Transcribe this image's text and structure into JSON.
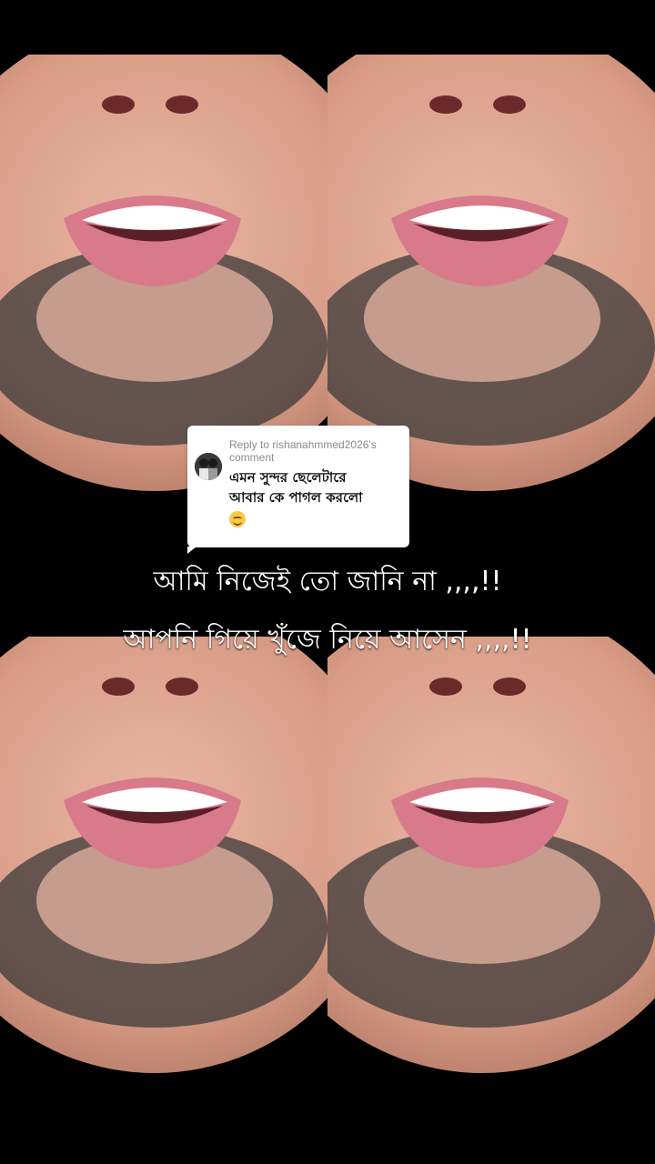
{
  "video": {
    "face_tiles": [
      {
        "label": "face-tile-top-left"
      },
      {
        "label": "face-tile-top-right"
      },
      {
        "label": "face-tile-bottom-left"
      },
      {
        "label": "face-tile-bottom-right"
      }
    ],
    "background_color": "#000000"
  },
  "reply_card": {
    "header": "Reply to rishanahmmed2026's comment",
    "comment_line1": "এমন সুন্দর ছেলেটারে",
    "comment_line2": "আবার কে পাগল করলো",
    "emoji_icon": "smiling-face-icon"
  },
  "captions": {
    "line1": "আমি নিজেই তো জানি না ,,,,!!",
    "line2": "আপনি গিয়ে খুঁজে নিয়ে আসেন  ,,,,!!"
  },
  "colors": {
    "skin": "#d9a08a",
    "lips": "#d87a8a",
    "beard": "#3a3a3a",
    "card_bg": "#ffffff"
  }
}
